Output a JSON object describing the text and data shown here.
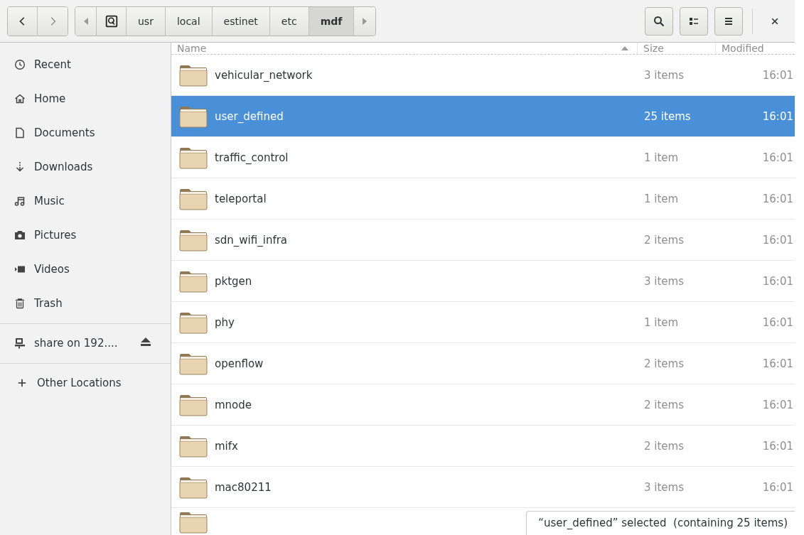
{
  "path_bar": {
    "segments": [
      {
        "kind": "root",
        "selected": false
      },
      {
        "kind": "text",
        "label": "usr",
        "selected": false
      },
      {
        "kind": "text",
        "label": "local",
        "selected": false
      },
      {
        "kind": "text",
        "label": "estinet",
        "selected": false
      },
      {
        "kind": "text",
        "label": "etc",
        "selected": false
      },
      {
        "kind": "text",
        "label": "mdf",
        "selected": true
      }
    ]
  },
  "sidebar": {
    "items": [
      {
        "kind": "place",
        "label": "Recent"
      },
      {
        "kind": "place",
        "label": "Home"
      },
      {
        "kind": "place",
        "label": "Documents"
      },
      {
        "kind": "place",
        "label": "Downloads"
      },
      {
        "kind": "place",
        "label": "Music"
      },
      {
        "kind": "place",
        "label": "Pictures"
      },
      {
        "kind": "place",
        "label": "Videos"
      },
      {
        "kind": "place",
        "label": "Trash"
      },
      {
        "kind": "mount",
        "label": "share on 192...."
      },
      {
        "kind": "action",
        "label": "Other Locations"
      }
    ]
  },
  "table": {
    "columns": [
      "Name",
      "Size",
      "Modified"
    ],
    "rows": [
      {
        "name": "vehicular_network",
        "size": "3 items",
        "modified": "16:01",
        "selected": false
      },
      {
        "name": "user_defined",
        "size": "25 items",
        "modified": "16:01",
        "selected": true
      },
      {
        "name": "traffic_control",
        "size": "1 item",
        "modified": "16:01",
        "selected": false
      },
      {
        "name": "teleportal",
        "size": "1 item",
        "modified": "16:01",
        "selected": false
      },
      {
        "name": "sdn_wifi_infra",
        "size": "2 items",
        "modified": "16:01",
        "selected": false
      },
      {
        "name": "pktgen",
        "size": "3 items",
        "modified": "16:01",
        "selected": false
      },
      {
        "name": "phy",
        "size": "1 item",
        "modified": "16:01",
        "selected": false
      },
      {
        "name": "openflow",
        "size": "2 items",
        "modified": "16:01",
        "selected": false
      },
      {
        "name": "mnode",
        "size": "2 items",
        "modified": "16:01",
        "selected": false
      },
      {
        "name": "mifx",
        "size": "2 items",
        "modified": "16:01",
        "selected": false
      },
      {
        "name": "mac80211",
        "size": "3 items",
        "modified": "16:01",
        "selected": false
      }
    ]
  },
  "status": "“user_defined” selected  (containing 25 items)"
}
